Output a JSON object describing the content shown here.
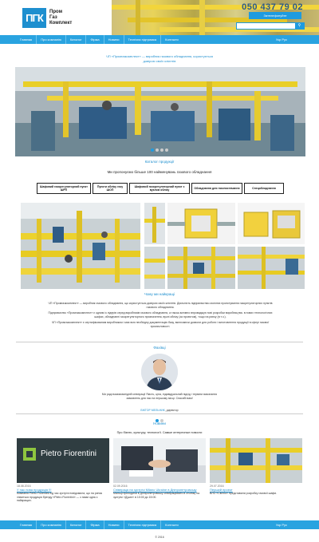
{
  "header": {
    "logo_text": "ПГК",
    "brand_line1": "Пром",
    "brand_line2": "Газ",
    "brand_line3": "Комплект",
    "phone": "050 437 79 02",
    "callback_label": "Зателефонуйте"
  },
  "nav": {
    "items": [
      "Главная",
      "Про компанію",
      "Каталог",
      "Фірма",
      "Новини",
      "Технічна підтримка",
      "Контакти"
    ],
    "lang": "Укр  Рус"
  },
  "tagline": {
    "line1": "ЧП «Промгазкомплект» — виробник газового обладнання, користується",
    "line2": "довірою своїх клієнтів"
  },
  "catalog": {
    "title": "Каталог продукції",
    "subtitle": "Ми пропонуємо більше 100 найменувань газового обладнання",
    "categories": [
      "Шафовий газорегуляторний пункт ШРП",
      "Пункти обліку газу ШОП",
      "Шафовий газорегуляторний пункт з вузлом обліку",
      "Обладнання для газопостачання",
      "Спецобладнання"
    ]
  },
  "about": {
    "title": "Чому ми найкращі",
    "p1": "ЧП «Промгазкомплект» — виробник газового обладнання, що користується довірою своїх клієнтів. Діяльність підприємства охоплює проектування газорегуляторних пунктів газового обладнання.",
    "p2": "Підприємство «Промгазкомплект» є одним із лідерів серед виробників газового обладнання, а також активно впроваджує нові розробки виробництва. в нових технологічних шафах, обладнанні газорегуляторного призначення, вузлі обліку (за проектом), тощо на ринку (в т.ч.).",
    "p3": "ЧП «Промгазкомплект» є сертифікованим виробником і має всю необхідну документацію базу, включаючи дозволи для роботи і виготовлення продукції в сфері газової промисловості."
  },
  "director": {
    "title": "Фахівці",
    "quote": "Ми раді взаємовигідній співпраці! Якість, ціна, індивідуальний підхід і терміни виконання замовлень для нас на першому місці. Спасибі вам!",
    "name": "ВІКТОР МЕЛЬНИК",
    "role": ", директор"
  },
  "news": {
    "title": "Новини",
    "subtitle": "Про бізнес, культуру, технології. Самые интересные новости",
    "items": [
      {
        "date": "18.08.2016",
        "title": "У нас нова продукція !!!",
        "text": "Компанія Pietro Fiorentini під час зустрічі повідомила, що на ринок з'явиться продукція бренду «Pietro Fiorentini» — з нами одна з найкращих.",
        "logo": "Pietro Fiorentini"
      },
      {
        "date": "02.09.2016",
        "title": "Співпраця на зустрічі Milano Ukraine в Дніпропетровську",
        "text": "Мальці приходили в Дніпропетровську співпрацювати в столиці на зустрічі «Дукат» в 10:00 до 15:00."
      },
      {
        "date": "29.07.2016",
        "title": "Перший проект",
        "text": "ВЛО «Світло» представили розробку газової шафи."
      }
    ]
  },
  "copyright": "© 2016"
}
